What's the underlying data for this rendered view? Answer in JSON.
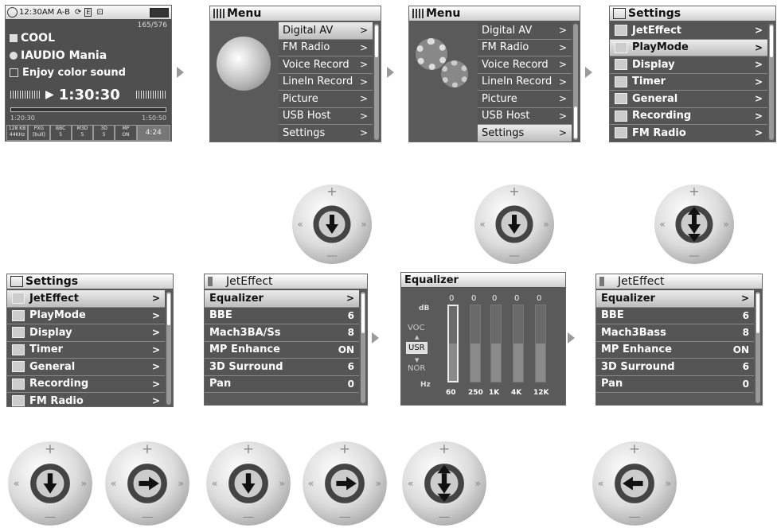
{
  "player": {
    "status_time": "12:30AM",
    "status_mode": "A-B",
    "track_count": "165/576",
    "title": "COOL",
    "artist": "IAUDIO Mania",
    "album": "Enjoy color sound",
    "time": "1:30:30",
    "elapsed": "1:20:30",
    "total": "1:50:50",
    "info_cells": [
      "128 KB\n44KHz",
      "PXG\n[bull]",
      "BBC\n5",
      "M3D\n5",
      "3D\n5",
      "MP\nON",
      "4:24"
    ]
  },
  "menu": {
    "title": "Menu",
    "items": [
      "Digital AV",
      "FM Radio",
      "Voice Record",
      "LineIn Record",
      "Picture",
      "USB Host",
      "Settings"
    ],
    "chevron": ">"
  },
  "settings": {
    "title": "Settings",
    "items": [
      "JetEffect",
      "PlayMode",
      "Display",
      "Timer",
      "General",
      "Recording",
      "FM Radio"
    ]
  },
  "jeteffect_1": {
    "title": "JetEffect",
    "items": [
      {
        "label": "Equalizer",
        "value": ">"
      },
      {
        "label": "BBE",
        "value": "6"
      },
      {
        "label": "Mach3BA/Ss",
        "value": "8"
      },
      {
        "label": "MP Enhance",
        "value": "ON"
      },
      {
        "label": "3D Surround",
        "value": "6"
      },
      {
        "label": "Pan",
        "value": "0"
      }
    ]
  },
  "jeteffect_2": {
    "title": "JetEffect",
    "items": [
      {
        "label": "Equalizer",
        "value": ">"
      },
      {
        "label": "BBE",
        "value": "6"
      },
      {
        "label": "Mach3Bass",
        "value": "8"
      },
      {
        "label": "MP Enhance",
        "value": "ON"
      },
      {
        "label": "3D Surround",
        "value": "6"
      },
      {
        "label": "Pan",
        "value": "0"
      }
    ]
  },
  "equalizer": {
    "title": "Equalizer",
    "db_label": "dB",
    "hz_label": "Hz",
    "presets": [
      "VOC",
      "USR",
      "NOR"
    ],
    "band_values": [
      "0",
      "0",
      "0",
      "0",
      "0"
    ],
    "band_labels": [
      "60",
      "250",
      "1K",
      "4K",
      "12K"
    ]
  },
  "wheel": {
    "plus": "+",
    "minus": "—",
    "left": "«",
    "right": "»"
  },
  "colors": {
    "screen_bg": "#5a5a5a",
    "highlight": "#dcdcdc"
  }
}
